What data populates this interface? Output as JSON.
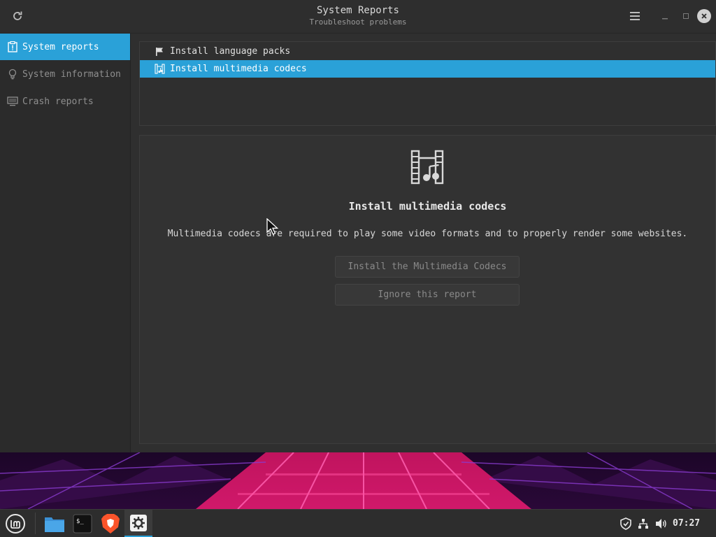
{
  "window": {
    "title": "System Reports",
    "subtitle": "Troubleshoot problems"
  },
  "sidebar": {
    "items": [
      {
        "label": "System reports",
        "icon": "report-icon",
        "active": true
      },
      {
        "label": "System information",
        "icon": "lightbulb-icon",
        "active": false
      },
      {
        "label": "Crash reports",
        "icon": "monitor-icon",
        "active": false
      }
    ]
  },
  "reports": {
    "items": [
      {
        "label": "Install language packs",
        "icon": "flag-icon",
        "selected": false
      },
      {
        "label": "Install multimedia codecs",
        "icon": "film-music-icon",
        "selected": true
      }
    ]
  },
  "detail": {
    "icon": "film-music-icon",
    "title": "Install multimedia codecs",
    "description": "Multimedia codecs are required to play some video formats and to properly render some websites.",
    "primary_button": "Install the Multimedia Codecs",
    "secondary_button": "Ignore this report"
  },
  "taskbar": {
    "apps": [
      "mint-menu-icon",
      "files-icon",
      "terminal-icon",
      "brave-browser-icon",
      "settings-icon"
    ],
    "tray": [
      "shield-icon",
      "network-icon",
      "volume-icon"
    ],
    "clock": "07:27"
  },
  "colors": {
    "accent": "#2aa1d8",
    "window_bg": "#2f2f2f",
    "taskbar_bg": "#2d2d2d"
  }
}
